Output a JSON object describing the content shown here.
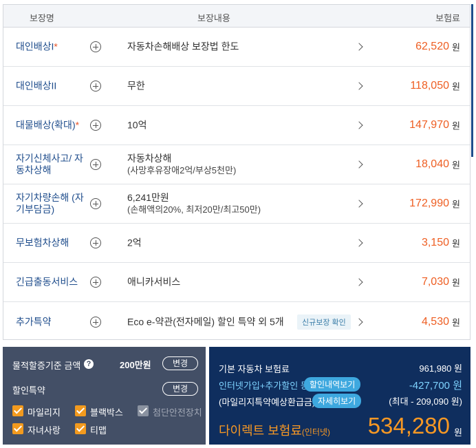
{
  "table": {
    "headers": {
      "name": "보장명",
      "content": "보장내용",
      "premium": "보험료"
    },
    "currency": "원",
    "rows": [
      {
        "name": "대인배상I",
        "star": "*",
        "content": "자동차손해배상 보장법 한도",
        "sub": "",
        "badge": "",
        "amount": "62,520"
      },
      {
        "name": "대인배상II",
        "star": "",
        "content": "무한",
        "sub": "",
        "badge": "",
        "amount": "118,050"
      },
      {
        "name": "대물배상(확대)",
        "star": "*",
        "content": "10억",
        "sub": "",
        "badge": "",
        "amount": "147,970"
      },
      {
        "name": "자기신체사고/ 자동차상해",
        "star": "",
        "content": "자동차상해",
        "sub": "(사망후유장애2억/부상5천만)",
        "badge": "",
        "amount": "18,040"
      },
      {
        "name": "자기차량손해 (자기부담금)",
        "star": "",
        "content": "6,241만원",
        "sub": "(손해액의20%, 최저20만/최고50만)",
        "badge": "",
        "amount": "172,990"
      },
      {
        "name": "무보험차상해",
        "star": "",
        "content": "2억",
        "sub": "",
        "badge": "",
        "amount": "3,150"
      },
      {
        "name": "긴급출동서비스",
        "star": "",
        "content": "애니카서비스",
        "sub": "",
        "badge": "",
        "amount": "7,030"
      },
      {
        "name": "추가특약",
        "star": "",
        "content": "Eco e-약관(전자메일) 할인 특약 외 5개",
        "sub": "",
        "badge": "신규보장 확인",
        "amount": "4,530"
      }
    ]
  },
  "left_panel": {
    "property_label": "물적할증기준 금액",
    "property_amount": "200만원",
    "change_label": "변경",
    "discount_label": "할인특약",
    "checkboxes": [
      {
        "label": "마일리지",
        "checked": true
      },
      {
        "label": "블랙박스",
        "checked": true
      },
      {
        "label": "첨단안전장치",
        "checked": false
      },
      {
        "label": "자녀사랑",
        "checked": true
      },
      {
        "label": "티맵",
        "checked": true
      }
    ]
  },
  "right_panel": {
    "base_label": "기본 자동차 보험료",
    "base_value": "961,980 원",
    "discount_label": "인터넷가입+추가할인 등",
    "discount_badge": "할인내역보기",
    "discount_value": "-427,700 원",
    "mileage_label": "(마일리지특약예상환급금)",
    "mileage_badge": "자세히보기",
    "mileage_value": "(최대 - 209,090 원)",
    "direct_label": "다이렉트 보험료",
    "direct_suffix": "(인터넷)",
    "final_amount": "534,280",
    "final_unit": "원"
  }
}
